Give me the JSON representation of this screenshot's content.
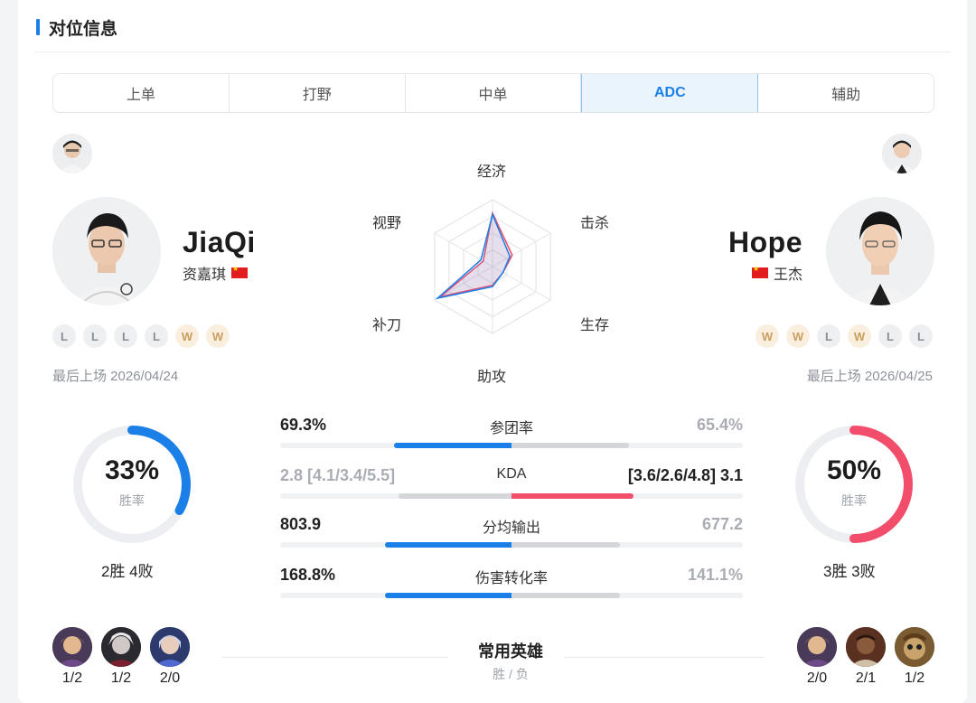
{
  "section": {
    "title": "对位信息"
  },
  "tabs": [
    {
      "label": "上单"
    },
    {
      "label": "打野"
    },
    {
      "label": "中单"
    },
    {
      "label": "ADC",
      "active": true
    },
    {
      "label": "辅助"
    }
  ],
  "left": {
    "name": "JiaQi",
    "realname": "资嘉琪",
    "results": [
      "L",
      "L",
      "L",
      "L",
      "W",
      "W"
    ],
    "last_played": "最后上场 2026/04/24",
    "winrate_pct": "33%",
    "winrate_value": 0.33,
    "winrate_label": "胜率",
    "record": "2胜 4败",
    "heroes": [
      {
        "record": "1/2",
        "icon": "hero-ezreal-icon"
      },
      {
        "record": "1/2",
        "icon": "hero-zeri-icon"
      },
      {
        "record": "2/0",
        "icon": "hero-ashe-icon"
      }
    ]
  },
  "right": {
    "name": "Hope",
    "realname": "王杰",
    "results": [
      "W",
      "W",
      "L",
      "W",
      "L",
      "L"
    ],
    "last_played": "最后上场 2026/04/25",
    "winrate_pct": "50%",
    "winrate_value": 0.5,
    "winrate_label": "胜率",
    "record": "3胜 3败",
    "heroes": [
      {
        "record": "2/0",
        "icon": "hero-ezreal-icon"
      },
      {
        "record": "2/1",
        "icon": "hero-lucian-icon"
      },
      {
        "record": "1/2",
        "icon": "hero-kogmaw-icon"
      }
    ]
  },
  "radar": {
    "labels": {
      "top": "经济",
      "upper_right": "击杀",
      "lower_right": "生存",
      "bottom": "助攻",
      "lower_left": "补刀",
      "upper_left": "视野"
    },
    "left_values": [
      0.78,
      0.3,
      0.18,
      0.3,
      0.95,
      0.2
    ],
    "right_values": [
      0.8,
      0.34,
      0.18,
      0.28,
      0.9,
      0.16
    ]
  },
  "stats": [
    {
      "name": "参团率",
      "left": "69.3%",
      "right": "65.4%",
      "winner": "left",
      "left_frac": 0.5,
      "right_frac": 0.5
    },
    {
      "name": "KDA",
      "left": "2.8 [4.1/3.4/5.5]",
      "right": "[3.6/2.6/4.8] 3.1",
      "winner": "right",
      "left_frac": 0.48,
      "right_frac": 0.52
    },
    {
      "name": "分均输出",
      "left": "803.9",
      "right": "677.2",
      "winner": "left",
      "left_frac": 0.54,
      "right_frac": 0.46
    },
    {
      "name": "伤害转化率",
      "left": "168.8%",
      "right": "141.1%",
      "winner": "left",
      "left_frac": 0.54,
      "right_frac": 0.46
    }
  ],
  "common_heroes": {
    "title": "常用英雄",
    "subtitle": "胜 / 负"
  },
  "colors": {
    "blue": "#1a7fe6",
    "red": "#f24d6b",
    "ring_track": "#eceef1"
  }
}
